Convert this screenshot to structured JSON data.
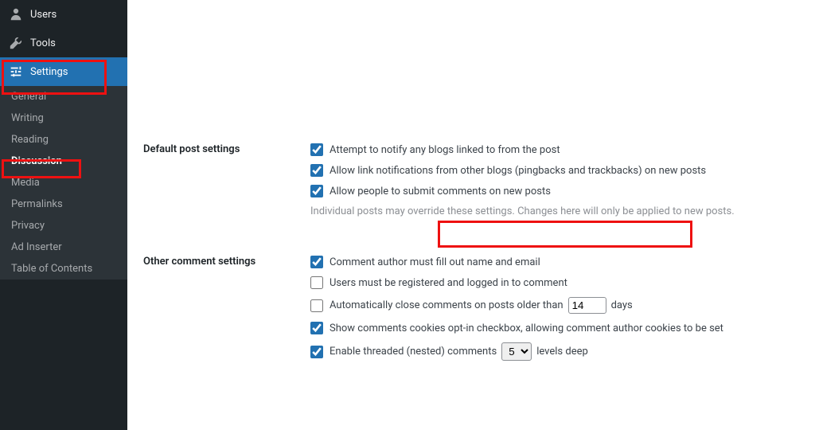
{
  "sidebar": {
    "top": [
      {
        "id": "users",
        "label": "Users",
        "icon": "user"
      },
      {
        "id": "tools",
        "label": "Tools",
        "icon": "wrench"
      },
      {
        "id": "settings",
        "label": "Settings",
        "icon": "sliders"
      }
    ],
    "settings_sub": [
      {
        "id": "general",
        "label": "General"
      },
      {
        "id": "writing",
        "label": "Writing"
      },
      {
        "id": "reading",
        "label": "Reading"
      },
      {
        "id": "discussion",
        "label": "Discussion",
        "current": true
      },
      {
        "id": "media",
        "label": "Media"
      },
      {
        "id": "permalinks",
        "label": "Permalinks"
      },
      {
        "id": "privacy",
        "label": "Privacy"
      },
      {
        "id": "ad-inserter",
        "label": "Ad Inserter"
      },
      {
        "id": "table-of-contents",
        "label": "Table of Contents"
      }
    ]
  },
  "sections": {
    "default_post": {
      "heading": "Default post settings",
      "opt_notify": {
        "label": "Attempt to notify any blogs linked to from the post",
        "checked": true
      },
      "opt_pingback": {
        "label": "Allow link notifications from other blogs (pingbacks and trackbacks) on new posts",
        "checked": true
      },
      "opt_allow_comments": {
        "label": "Allow people to submit comments on new posts",
        "checked": true
      },
      "note": "Individual posts may override these settings. Changes here will only be applied to new posts."
    },
    "other_comment": {
      "heading": "Other comment settings",
      "opt_name_email": {
        "label": "Comment author must fill out name and email",
        "checked": true
      },
      "opt_registered": {
        "label": "Users must be registered and logged in to comment",
        "checked": false
      },
      "opt_autoclose": {
        "label_pre": "Automatically close comments on posts older than",
        "value": "14",
        "label_post": "days",
        "checked": false
      },
      "opt_cookies": {
        "label": "Show comments cookies opt-in checkbox, allowing comment author cookies to be set",
        "checked": true
      },
      "opt_threaded": {
        "label_pre": "Enable threaded (nested) comments",
        "value": "5",
        "label_post": "levels deep",
        "checked": true
      }
    }
  }
}
